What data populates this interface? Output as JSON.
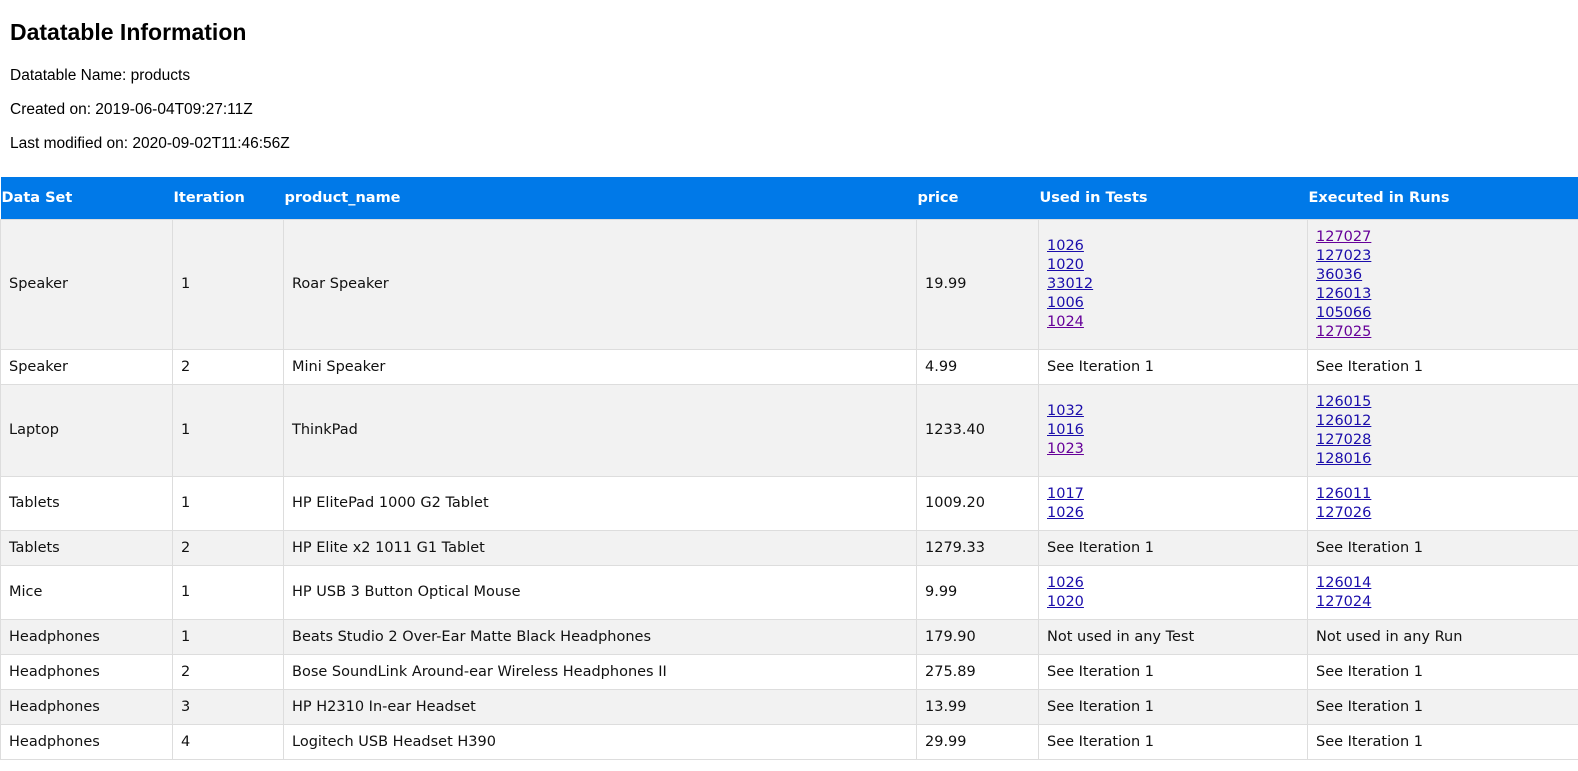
{
  "info": {
    "title": "Datatable Information",
    "name_line": "Datatable Name: products",
    "created_line": "Created on: 2019-06-04T09:27:11Z",
    "modified_line": "Last modified on: 2020-09-02T11:46:56Z"
  },
  "table": {
    "headers": [
      "Data Set",
      "Iteration",
      "product_name",
      "price",
      "Used in Tests",
      "Executed in Runs"
    ],
    "rows": [
      {
        "data_set": "Speaker",
        "iteration": "1",
        "product_name": "Roar Speaker",
        "price": "19.99",
        "tests": [
          "1026",
          "1020",
          "33012",
          "1006",
          "1024"
        ],
        "runs": [
          "127027",
          "127023",
          "36036",
          "126013",
          "105066",
          "127025"
        ]
      },
      {
        "data_set": "Speaker",
        "iteration": "2",
        "product_name": "Mini Speaker",
        "price": "4.99",
        "tests_text": "See Iteration 1",
        "runs_text": "See Iteration 1"
      },
      {
        "data_set": "Laptop",
        "iteration": "1",
        "product_name": "ThinkPad",
        "price": "1233.40",
        "tests": [
          "1032",
          "1016",
          "1023"
        ],
        "runs": [
          "126015",
          "126012",
          "127028",
          "128016"
        ]
      },
      {
        "data_set": "Tablets",
        "iteration": "1",
        "product_name": "HP ElitePad 1000 G2 Tablet",
        "price": "1009.20",
        "tests": [
          "1017",
          "1026"
        ],
        "runs": [
          "126011",
          "127026"
        ]
      },
      {
        "data_set": "Tablets",
        "iteration": "2",
        "product_name": "HP Elite x2 1011 G1 Tablet",
        "price": "1279.33",
        "tests_text": "See Iteration 1",
        "runs_text": "See Iteration 1"
      },
      {
        "data_set": "Mice",
        "iteration": "1",
        "product_name": "HP USB 3 Button Optical Mouse",
        "price": "9.99",
        "tests": [
          "1026",
          "1020"
        ],
        "runs": [
          "126014",
          "127024"
        ]
      },
      {
        "data_set": "Headphones",
        "iteration": "1",
        "product_name": "Beats Studio 2 Over-Ear Matte Black Headphones",
        "price": "179.90",
        "tests_text": "Not used in any Test",
        "runs_text": "Not used in any Run"
      },
      {
        "data_set": "Headphones",
        "iteration": "2",
        "product_name": "Bose SoundLink Around-ear Wireless Headphones II",
        "price": "275.89",
        "tests_text": "See Iteration 1",
        "runs_text": "See Iteration 1"
      },
      {
        "data_set": "Headphones",
        "iteration": "3",
        "product_name": "HP H2310 In-ear Headset",
        "price": "13.99",
        "tests_text": "See Iteration 1",
        "runs_text": "See Iteration 1"
      },
      {
        "data_set": "Headphones",
        "iteration": "4",
        "product_name": "Logitech USB Headset H390",
        "price": "29.99",
        "tests_text": "See Iteration 1",
        "runs_text": "See Iteration 1"
      }
    ]
  },
  "colors": {
    "header_bg": "#0079e8",
    "link": "#1a0dab",
    "visited_link": "#660099",
    "row_alt": "#f2f2f2"
  }
}
